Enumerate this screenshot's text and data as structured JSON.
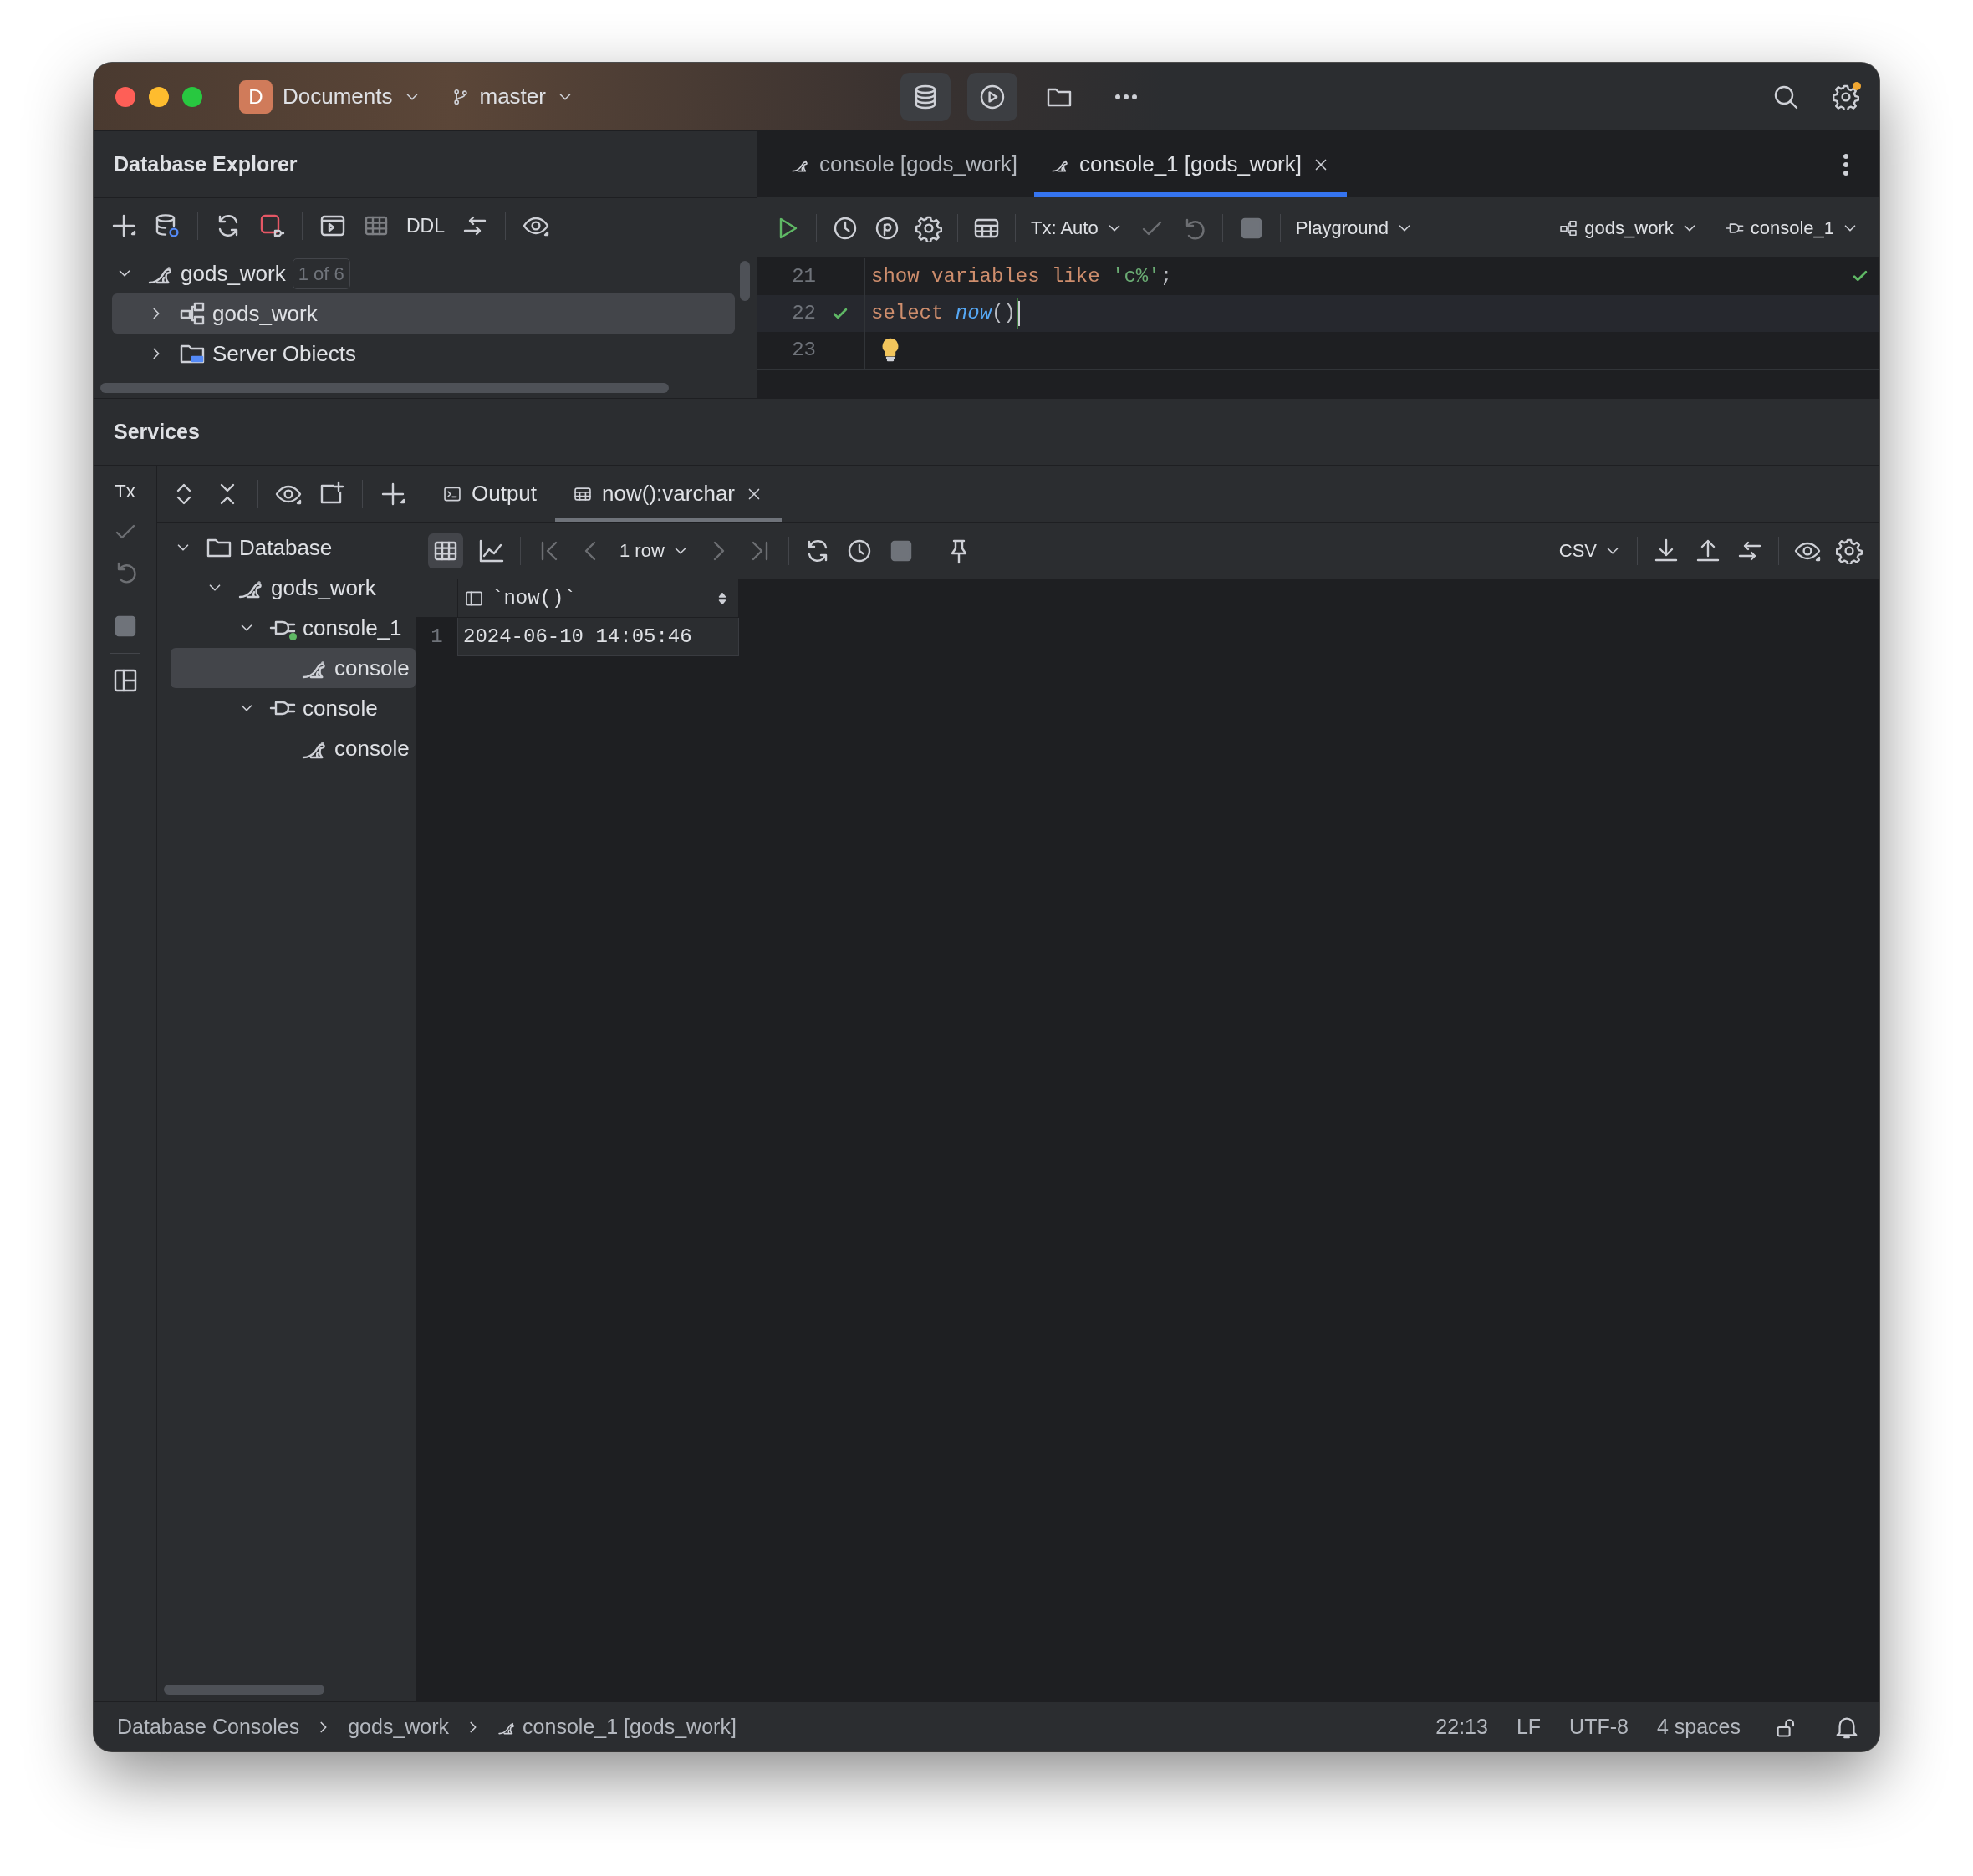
{
  "title_bar": {
    "project_badge": "D",
    "project": "Documents",
    "branch": "master"
  },
  "explorer": {
    "title": "Database Explorer",
    "toolbar_label": "DDL",
    "tree": [
      {
        "label": "gods_work",
        "badge": "1 of 6",
        "kind": "datasource",
        "expanded": true,
        "selected": false,
        "children": [
          {
            "label": "gods_work",
            "kind": "schema",
            "expanded": false,
            "selected": true
          },
          {
            "label": "Server Obiects",
            "kind": "server",
            "expanded": false,
            "selected": false
          }
        ]
      }
    ]
  },
  "editor": {
    "tabs": [
      {
        "label": "console [gods_work]",
        "selected": false
      },
      {
        "label": "console_1 [gods_work]",
        "selected": true
      }
    ],
    "toolbar": {
      "tx": "Tx: Auto",
      "mode": "Playground",
      "schema": "gods_work",
      "session": "console_1"
    },
    "lines": [
      {
        "number": "21",
        "executed": false,
        "current": false,
        "hint": false,
        "tokens": [
          {
            "kind": "keyword",
            "text": "show variables like "
          },
          {
            "kind": "string",
            "text": "'c%'"
          },
          {
            "kind": "plain",
            "text": ";"
          }
        ]
      },
      {
        "number": "22",
        "executed": true,
        "current": true,
        "hint": false,
        "tokens": [
          {
            "kind": "keyword",
            "text": "select "
          },
          {
            "kind": "function",
            "text": "now"
          },
          {
            "kind": "plain",
            "text": "()"
          }
        ]
      },
      {
        "number": "23",
        "executed": false,
        "current": false,
        "hint": true
      }
    ]
  },
  "services": {
    "title": "Services",
    "side_label": "Tx",
    "tree": [
      {
        "label": "Database",
        "kind": "folder",
        "expanded": true,
        "selected": false,
        "children": [
          {
            "label": "gods_work",
            "kind": "datasource",
            "expanded": true,
            "selected": false,
            "children": [
              {
                "label": "console_1",
                "kind": "session",
                "online": true,
                "expanded": true,
                "selected": false,
                "children": [
                  {
                    "label": "console",
                    "kind": "console",
                    "selected": true
                  }
                ]
              },
              {
                "label": "console",
                "kind": "session",
                "online": false,
                "expanded": true,
                "selected": false,
                "children": [
                  {
                    "label": "console",
                    "kind": "console",
                    "selected": false
                  }
                ]
              }
            ]
          }
        ]
      }
    ],
    "tabs": [
      {
        "label": "Output",
        "kind": "output",
        "selected": false
      },
      {
        "label": "now():varchar",
        "kind": "table",
        "selected": true
      }
    ],
    "results": {
      "page": "1 row",
      "format": "CSV",
      "columns": [
        "`now()`"
      ],
      "rows": [
        {
          "number": "1",
          "cells": [
            "2024-06-10 14:05:46"
          ]
        }
      ]
    }
  },
  "status_bar": {
    "breadcrumbs": [
      "Database Consoles",
      "gods_work",
      "console_1 [gods_work]"
    ],
    "position": "22:13",
    "line_ending": "LF",
    "encoding": "UTF-8",
    "indent": "4 spaces"
  }
}
